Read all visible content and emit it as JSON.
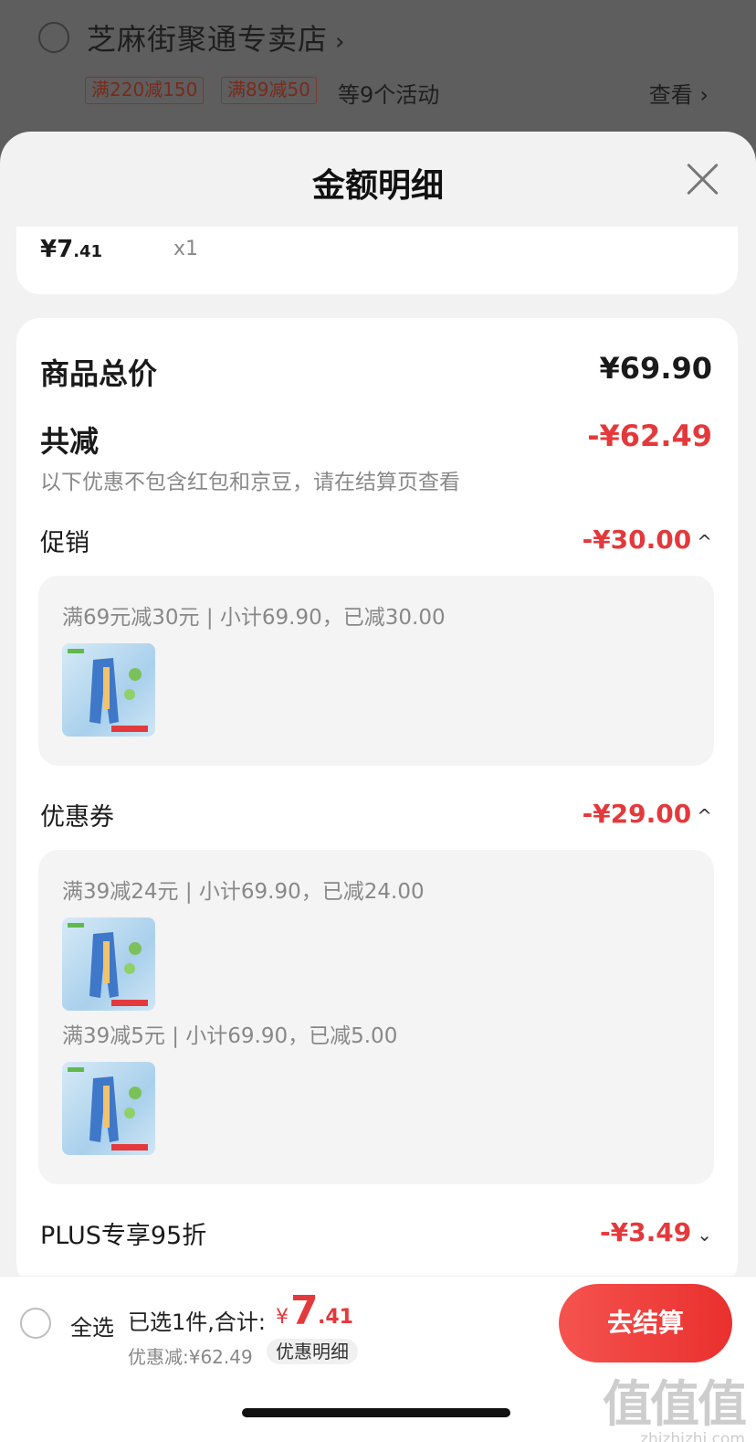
{
  "store": {
    "name": "芝麻街聚通专卖店",
    "chevron": "›",
    "promos": [
      "满220减150",
      "满89减50"
    ],
    "more_promos": "等9个活动",
    "view_label": "查看 ›"
  },
  "sheet": {
    "title": "金额明细",
    "close_icon": "close-icon"
  },
  "item": {
    "price_main": "¥7",
    "price_dec": ".41",
    "qty": "x1"
  },
  "summary": {
    "total_label": "商品总价",
    "total_value": "¥69.90",
    "reduced_label": "共减",
    "reduced_value": "-¥62.49",
    "note": "以下优惠不包含红包和京豆，请在结算页查看"
  },
  "promotion": {
    "label": "促销",
    "value": "-¥30.00",
    "caret": "^",
    "line": "满69元减30元 | 小计69.90，已减30.00"
  },
  "coupon": {
    "label": "优惠券",
    "value": "-¥29.00",
    "caret": "^",
    "lines": [
      "满39减24元 | 小计69.90，已减24.00",
      "满39减5元 | 小计69.90，已减5.00"
    ]
  },
  "plus": {
    "label": "PLUS专享95折",
    "value": "-¥3.49",
    "caret": "⌄"
  },
  "bottom": {
    "select_all": "全选",
    "selected": "已选1件,合计:",
    "currency": "¥",
    "total_int": "7",
    "total_dec": ".41",
    "discount": "优惠减:¥62.49",
    "detail": "优惠明细",
    "checkout": "去结算"
  },
  "watermark": {
    "glyph": "值值值",
    "site": "zhizhizhi.com"
  },
  "colors": {
    "accent_red": "#e4393c",
    "sheet_bg": "#f2f2f2"
  }
}
